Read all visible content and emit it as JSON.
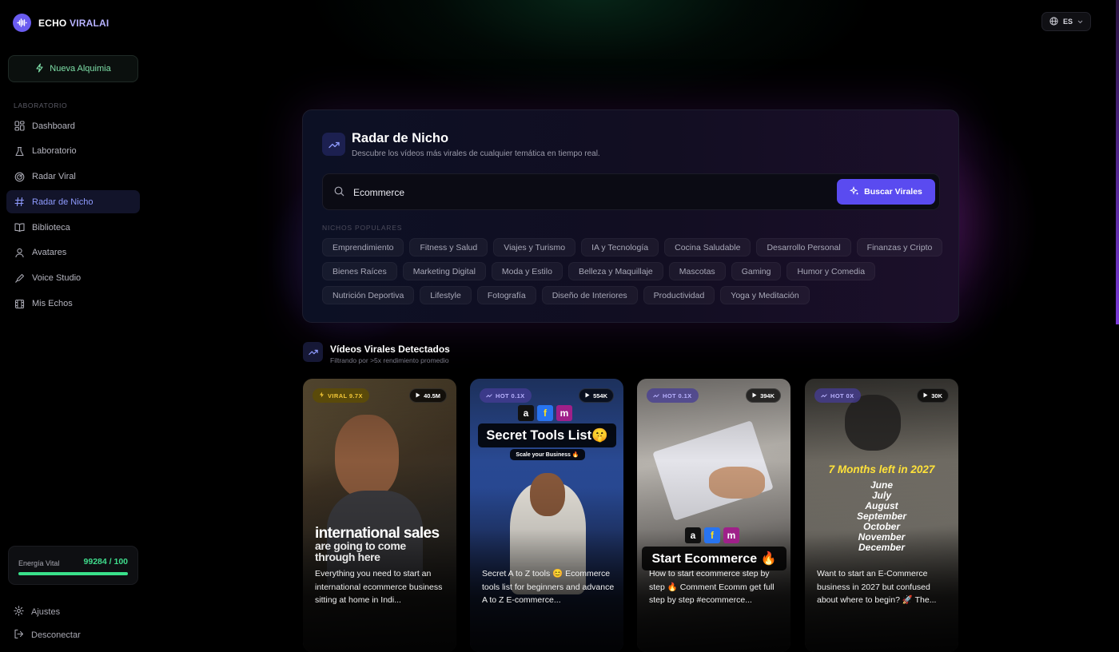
{
  "app": {
    "brand_main": "ECHO",
    "brand_accent": "VIRALAI",
    "language": "ES"
  },
  "sidebar": {
    "new_button": "Nueva Alquimia",
    "section_label": "LABORATORIO",
    "items": [
      {
        "label": "Dashboard",
        "icon": "dashboard-icon",
        "active": false
      },
      {
        "label": "Laboratorio",
        "icon": "flask-icon",
        "active": false
      },
      {
        "label": "Radar Viral",
        "icon": "radar-icon",
        "active": false
      },
      {
        "label": "Radar de Nicho",
        "icon": "hash-icon",
        "active": true
      },
      {
        "label": "Biblioteca",
        "icon": "book-icon",
        "active": false
      },
      {
        "label": "Avatares",
        "icon": "user-icon",
        "active": false
      },
      {
        "label": "Voice Studio",
        "icon": "mic-icon",
        "active": false
      },
      {
        "label": "Mis Echos",
        "icon": "film-icon",
        "active": false
      }
    ],
    "energy": {
      "label": "Energía Vital",
      "value": "99284 / 100",
      "fill_fraction": 1.0
    },
    "settings": "Ajustes",
    "logout": "Desconectar"
  },
  "radar": {
    "title": "Radar de Nicho",
    "subtitle": "Descubre los vídeos más virales de cualquier temática en tiempo real.",
    "search_value": "Ecommerce",
    "search_button": "Buscar Virales",
    "popular_label": "NICHOS POPULARES",
    "niches": [
      "Emprendimiento",
      "Fitness y Salud",
      "Viajes y Turismo",
      "IA y Tecnología",
      "Cocina Saludable",
      "Desarrollo Personal",
      "Finanzas y Cripto",
      "Bienes Raíces",
      "Marketing Digital",
      "Moda y Estilo",
      "Belleza y Maquillaje",
      "Mascotas",
      "Gaming",
      "Humor y Comedia",
      "Nutrición Deportiva",
      "Lifestyle",
      "Fotografía",
      "Diseño de Interiores",
      "Productividad",
      "Yoga y Meditación"
    ]
  },
  "videos": {
    "title": "Vídeos Virales Detectados",
    "subtitle": "Filtrando por >5x rendimiento promedio",
    "cards": [
      {
        "badge": "VIRAL 9.7X",
        "badge_type": "viral",
        "views": "40.5M",
        "overlay": [
          "international sales",
          "are going to come",
          "through here"
        ],
        "caption": "Everything you need to start an international ecommerce business sitting at home in Indi..."
      },
      {
        "badge": "HOT 0.1X",
        "badge_type": "hot",
        "views": "554K",
        "overlay": [
          "Secret Tools List🤫",
          "Scale your Business 🔥"
        ],
        "caption": "Secret A to Z tools 😊 Ecommerce tools list for beginners and advance A to Z E-commerce..."
      },
      {
        "badge": "HOT 0.1X",
        "badge_type": "hot",
        "views": "394K",
        "overlay": [
          "Start Ecommerce 🔥"
        ],
        "caption": "How to start ecommerce step by step 🔥 Comment Ecomm get full step by step #ecommerce..."
      },
      {
        "badge": "HOT 0X",
        "badge_type": "hot",
        "views": "30K",
        "overlay": [
          "7 Months left in 2027",
          "June",
          "July",
          "August",
          "September",
          "October",
          "November",
          "December"
        ],
        "caption": "Want to start an E-Commerce business in 2027 but confused about where to begin? 🚀 The..."
      }
    ]
  },
  "colors": {
    "accent": "#5a4bf0",
    "energy": "#39e08a",
    "viral": "#f2c737"
  }
}
